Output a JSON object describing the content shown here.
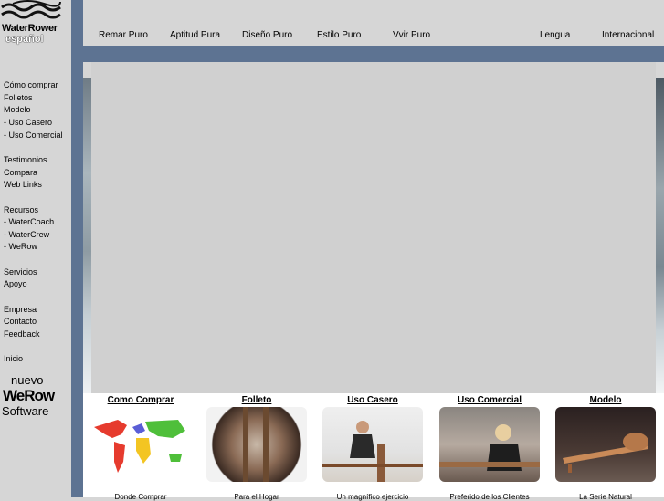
{
  "brand": {
    "line1": "WaterRower",
    "line2": "español"
  },
  "top_nav": [
    "Remar Puro",
    "Aptitud Pura",
    "Diseño Puro",
    "Estilo Puro",
    "Vvir Puro"
  ],
  "top_right": [
    "Lengua",
    "Internacional"
  ],
  "side_nav": [
    "Cómo comprar",
    "Folletos",
    "Modelo",
    "- Uso Casero",
    "- Uso Comercial",
    "Testimonios",
    "Compara",
    "Web Links",
    "Recursos",
    "- WaterCoach",
    "- WaterCrew",
    "- WeRow",
    "Servicios",
    "Apoyo",
    "Empresa",
    "Contacto",
    "Feedback",
    "Inicio"
  ],
  "promo": {
    "line1": "nuevo",
    "logo": "WeRow",
    "line3": "Software"
  },
  "features": [
    {
      "title": "Como Comprar",
      "caption": "Donde Comprar"
    },
    {
      "title": "Folleto",
      "caption": "Para el Hogar"
    },
    {
      "title": "Uso Casero",
      "caption": "Un magnífico ejercicio"
    },
    {
      "title": "Uso Comercial",
      "caption": "Preferido de los Clientes"
    },
    {
      "title": "Modelo",
      "caption": "La Serie Natural"
    }
  ],
  "colors": {
    "band": "#5d7392",
    "background": "#d6d6d6"
  }
}
